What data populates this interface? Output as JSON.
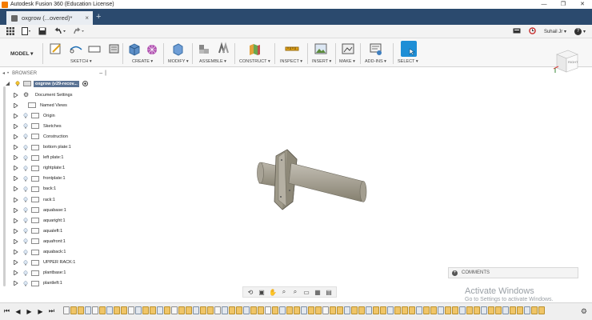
{
  "window": {
    "title": "Autodesk Fusion 360 (Education License)",
    "controls": [
      "—",
      "❐",
      "✕"
    ]
  },
  "tab": {
    "title": "oxgrow (...overed)*",
    "close": "×",
    "new": "+"
  },
  "qabar": {
    "user": "Suhail Jr",
    "help": "?"
  },
  "ribbon": {
    "workspace": "MODEL ▾",
    "groups": [
      "SKETCH ▾",
      "CREATE ▾",
      "MODIFY ▾",
      "ASSEMBLE ▾",
      "CONSTRUCT ▾",
      "INSPECT ▾",
      "INSERT ▾",
      "MAKE ▾",
      "ADD-INS ▾",
      "SELECT ▾"
    ]
  },
  "browser": {
    "title": "BROWSER",
    "root": "oxgrow (v29-recov...",
    "items": [
      "Document Settings",
      "Named Views",
      "Origin",
      "Sketches",
      "Construction",
      "bottom plate:1",
      "left plate:1",
      "rightplate:1",
      "frontplate:1",
      "back:1",
      "rack:1",
      "aquabase:1",
      "aquaright:1",
      "aqualeft:1",
      "aquafront:1",
      "aquaback:1",
      "UPPER RACK:1",
      "plantbase:1",
      "plantleft:1"
    ]
  },
  "viewcube": {
    "label": "RIGHT"
  },
  "comments": {
    "label": "COMMENTS"
  },
  "watermark": {
    "line1": "Activate Windows",
    "line2": "Go to Settings to activate Windows."
  },
  "colors": {
    "tabbar": "#2b4a6e",
    "root_highlight": "#5b7394",
    "select_accent": "#1f8fd6",
    "model": "#a7a296"
  }
}
